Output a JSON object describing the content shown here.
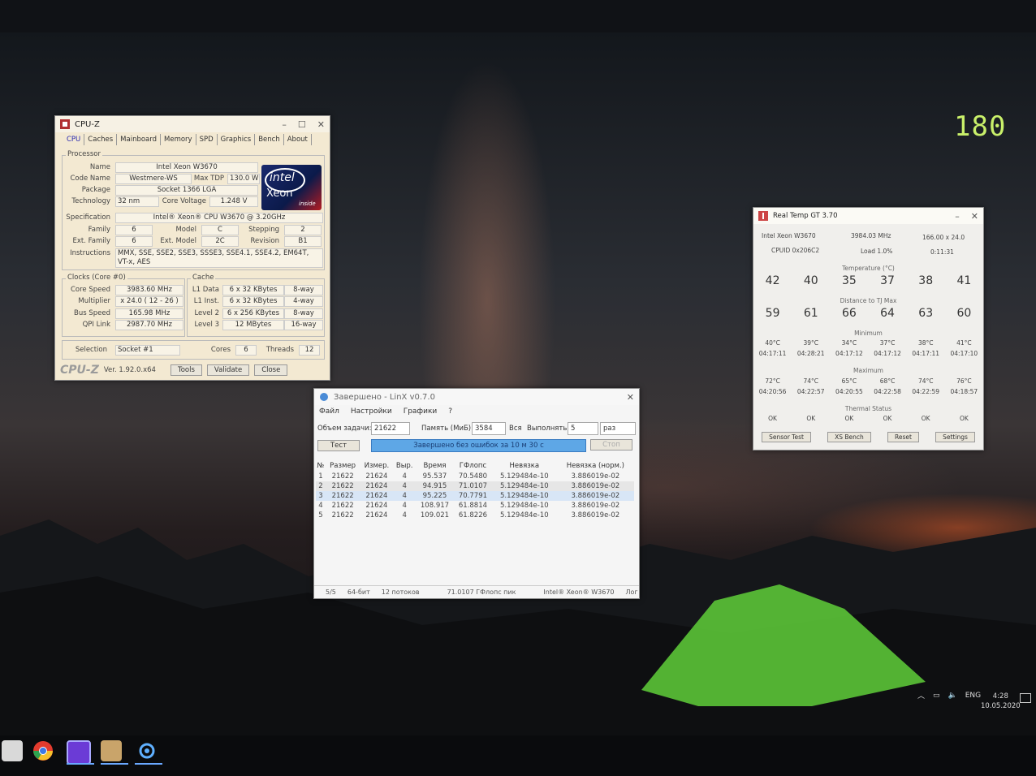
{
  "overlay": {
    "fps": "180"
  },
  "cpuz": {
    "title": "CPU-Z",
    "tabs": [
      "CPU",
      "Caches",
      "Mainboard",
      "Memory",
      "SPD",
      "Graphics",
      "Bench",
      "About"
    ],
    "processor": {
      "group": "Processor",
      "name_label": "Name",
      "name": "Intel Xeon W3670",
      "codename_label": "Code Name",
      "codename": "Westmere-WS",
      "maxtdp_label": "Max TDP",
      "maxtdp": "130.0 W",
      "package_label": "Package",
      "package": "Socket 1366 LGA",
      "technology_label": "Technology",
      "technology": "32 nm",
      "voltage_label": "Core Voltage",
      "voltage": "1.248 V",
      "spec_label": "Specification",
      "spec": "Intel® Xeon® CPU      W3670  @ 3.20GHz",
      "family_label": "Family",
      "family": "6",
      "model_label": "Model",
      "model": "C",
      "stepping_label": "Stepping",
      "stepping": "2",
      "extfamily_label": "Ext. Family",
      "extfamily": "6",
      "extmodel_label": "Ext. Model",
      "extmodel": "2C",
      "revision_label": "Revision",
      "revision": "B1",
      "instructions_label": "Instructions",
      "instructions": "MMX, SSE, SSE2, SSE3, SSSE3, SSE4.1, SSE4.2, EM64T, VT-x, AES",
      "logo": {
        "brand": "intel",
        "product": "Xeon",
        "tag": "inside"
      }
    },
    "clocks": {
      "group": "Clocks (Core #0)",
      "core_speed_label": "Core Speed",
      "core_speed": "3983.60 MHz",
      "multiplier_label": "Multiplier",
      "multiplier": "x 24.0 ( 12 - 26 )",
      "bus_speed_label": "Bus Speed",
      "bus_speed": "165.98 MHz",
      "qpi_label": "QPI Link",
      "qpi": "2987.70 MHz"
    },
    "cache": {
      "group": "Cache",
      "l1d_label": "L1 Data",
      "l1d": "6 x 32 KBytes",
      "l1d_way": "8-way",
      "l1i_label": "L1 Inst.",
      "l1i": "6 x 32 KBytes",
      "l1i_way": "4-way",
      "l2_label": "Level 2",
      "l2": "6 x 256 KBytes",
      "l2_way": "8-way",
      "l3_label": "Level 3",
      "l3": "12 MBytes",
      "l3_way": "16-way"
    },
    "selection_label": "Selection",
    "selection": "Socket #1",
    "cores_label": "Cores",
    "cores": "6",
    "threads_label": "Threads",
    "threads": "12",
    "footer": {
      "brand": "CPU-Z",
      "version": "Ver. 1.92.0.x64",
      "tools": "Tools",
      "validate": "Validate",
      "close": "Close"
    }
  },
  "realtemp": {
    "title": "Real Temp GT 3.70",
    "cpu": "Intel Xeon W3670",
    "mhz": "3984.03 MHz",
    "mult": "166.00 x 24.0",
    "cpuid": "CPUID  0x206C2",
    "load": "Load  1.0%",
    "time": "0:11:31",
    "temp_head": "Temperature (°C)",
    "temps": [
      "42",
      "40",
      "35",
      "37",
      "38",
      "41"
    ],
    "dist_head": "Distance to TJ Max",
    "dist": [
      "59",
      "61",
      "66",
      "64",
      "63",
      "60"
    ],
    "min_head": "Minimum",
    "min_t": [
      "40°C",
      "39°C",
      "34°C",
      "37°C",
      "38°C",
      "41°C"
    ],
    "min_time": [
      "04:17:11",
      "04:28:21",
      "04:17:12",
      "04:17:12",
      "04:17:11",
      "04:17:10"
    ],
    "max_head": "Maximum",
    "max_t": [
      "72°C",
      "74°C",
      "65°C",
      "68°C",
      "74°C",
      "76°C"
    ],
    "max_time": [
      "04:20:56",
      "04:22:57",
      "04:20:55",
      "04:22:58",
      "04:22:59",
      "04:18:57"
    ],
    "thermal_head": "Thermal Status",
    "thermal": [
      "OK",
      "OK",
      "OK",
      "OK",
      "OK",
      "OK"
    ],
    "buttons": {
      "sensor": "Sensor Test",
      "xs": "XS Bench",
      "reset": "Reset",
      "settings": "Settings"
    }
  },
  "linx": {
    "title": "Завершено - LinX v0.7.0",
    "menu": [
      "Файл",
      "Настройки",
      "Графики",
      "?"
    ],
    "task_label": "Объем задачи:",
    "task_value": "21622",
    "mem_label": "Память (МиБ):",
    "mem_value": "3584",
    "all_label": "Вся",
    "run_label": "Выполнять:",
    "run_value": "5",
    "run_unit": "раз",
    "test_button": "Тест",
    "stop_button": "Стоп",
    "progress_text": "Завершено без ошибок за 10 м 30 с",
    "columns": [
      "№",
      "Размер",
      "Измер.",
      "Выр.",
      "Время",
      "ГФлопс",
      "Невязка",
      "Невязка (норм.)"
    ],
    "rows": [
      [
        "1",
        "21622",
        "21624",
        "4",
        "95.537",
        "70.5480",
        "5.129484e-10",
        "3.886019e-02"
      ],
      [
        "2",
        "21622",
        "21624",
        "4",
        "94.915",
        "71.0107",
        "5.129484e-10",
        "3.886019e-02"
      ],
      [
        "3",
        "21622",
        "21624",
        "4",
        "95.225",
        "70.7791",
        "5.129484e-10",
        "3.886019e-02"
      ],
      [
        "4",
        "21622",
        "21624",
        "4",
        "108.917",
        "61.8814",
        "5.129484e-10",
        "3.886019e-02"
      ],
      [
        "5",
        "21622",
        "21624",
        "4",
        "109.021",
        "61.8226",
        "5.129484e-10",
        "3.886019e-02"
      ]
    ],
    "status": {
      "count": "5/5",
      "bits": "64-бит",
      "threads": "12 потоков",
      "peak": "71.0107 ГФлопс пик",
      "cpu": "Intel® Xeon® W3670",
      "log": "Лог"
    }
  },
  "tray": {
    "lang": "ENG",
    "time": "4:28",
    "date": "10.05.2020"
  },
  "taskbar": {
    "icons": [
      "calculator-icon",
      "chrome-icon",
      "app-icon",
      "image-viewer-icon",
      "settings-icon"
    ]
  }
}
